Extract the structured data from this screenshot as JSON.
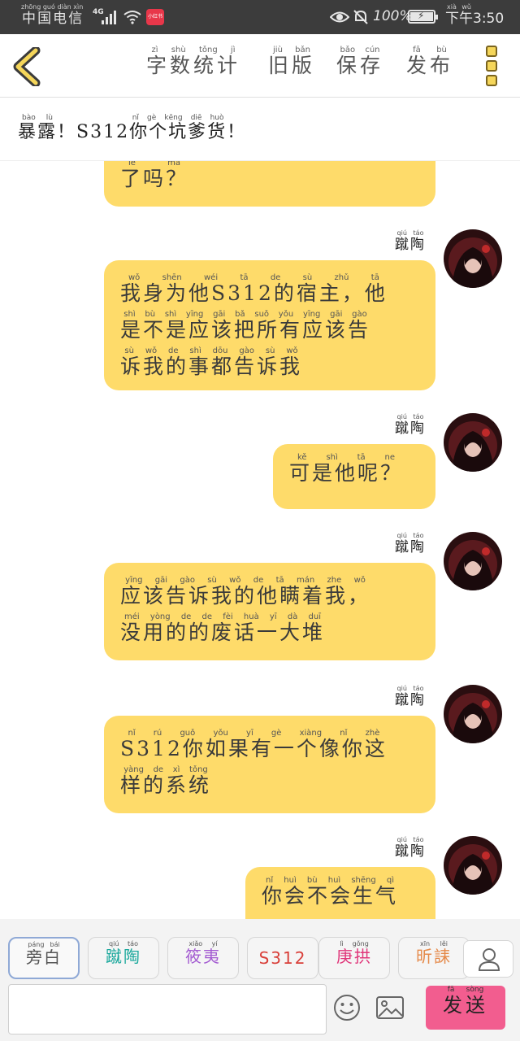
{
  "status_bar": {
    "carrier": {
      "text": "中国电信",
      "pinyin": "zhōng guó diàn xìn"
    },
    "network": "4G",
    "app_badge": "小红书",
    "battery_percent": "100%",
    "time": {
      "period": "下午",
      "period_pinyin": "xià wǔ",
      "clock": "3:50"
    }
  },
  "toolbar": {
    "word_count": {
      "text": "字数统计",
      "pinyin": "zì shù tǒng jì"
    },
    "old_version": {
      "text": "旧版",
      "pinyin": "jiù bǎn"
    },
    "save": {
      "text": "保存",
      "pinyin": "bǎo cún"
    },
    "publish": {
      "text": "发布",
      "pinyin": "fā bù"
    }
  },
  "title": {
    "text": "暴露！S312你个坑爹货！",
    "pinyin_a": "bào lù",
    "pinyin_b": "nǐ gè kēng diē huò"
  },
  "speaker_name": {
    "text": "蹴陶",
    "pinyin": "qiú táo"
  },
  "messages": [
    {
      "line1": "了吗？",
      "pinyin1": "le ma"
    },
    {
      "line1": "我身为他S312的宿主，他",
      "line2": "是不是应该把所有应该告",
      "line3": "诉我的事都告诉我",
      "pinyin1": "wǒ shēn wéi tā        de sù zhǔ    tā",
      "pinyin2": "shì bù shì yīng gāi bǎ suǒ yǒu yīng gāi gào",
      "pinyin3": "sù wǒ de shì dōu gào sù wǒ"
    },
    {
      "line1": "可是他呢？",
      "pinyin1": "kě shì tā ne"
    },
    {
      "line1": "应该告诉我的他瞒着我，",
      "line2": "没用的的废话一大堆",
      "pinyin1": "yīng gāi gào sù wǒ de tā mán zhe wǒ",
      "pinyin2": "méi yòng de de fèi huà yī dà duī"
    },
    {
      "line1": "S312你如果有一个像你这",
      "line2": "样的系统",
      "pinyin1": "nǐ rú guǒ yǒu yī gè xiàng nǐ zhè",
      "pinyin2": "yàng de xì tǒng"
    },
    {
      "line1": "你会不会生气",
      "pinyin1": "nǐ huì bù huì shēng qì"
    }
  ],
  "character_tabs": [
    {
      "text": "旁白",
      "pinyin": "páng bái",
      "color": "#555555"
    },
    {
      "text": "蹴陶",
      "pinyin": "qiú táo",
      "color": "#1aa89c"
    },
    {
      "text": "筱夷",
      "pinyin": "xiǎo yí",
      "color": "#a35bd1"
    },
    {
      "text": "S312",
      "pinyin": "",
      "color": "#d9403a"
    },
    {
      "text": "庚拱",
      "pinyin": "lì gǒng",
      "color": "#e0367a"
    },
    {
      "text": "昕誄",
      "pinyin": "xīn lěi",
      "color": "#e58a4a"
    }
  ],
  "input": {
    "value": "",
    "placeholder": ""
  },
  "send_button": {
    "text": "发送",
    "pinyin": "fā sòng"
  },
  "colors": {
    "bubble": "#fedb6a",
    "send": "#f25d8f",
    "status_bar": "#3c3c3c",
    "back_arrow": "#f5d65a"
  }
}
